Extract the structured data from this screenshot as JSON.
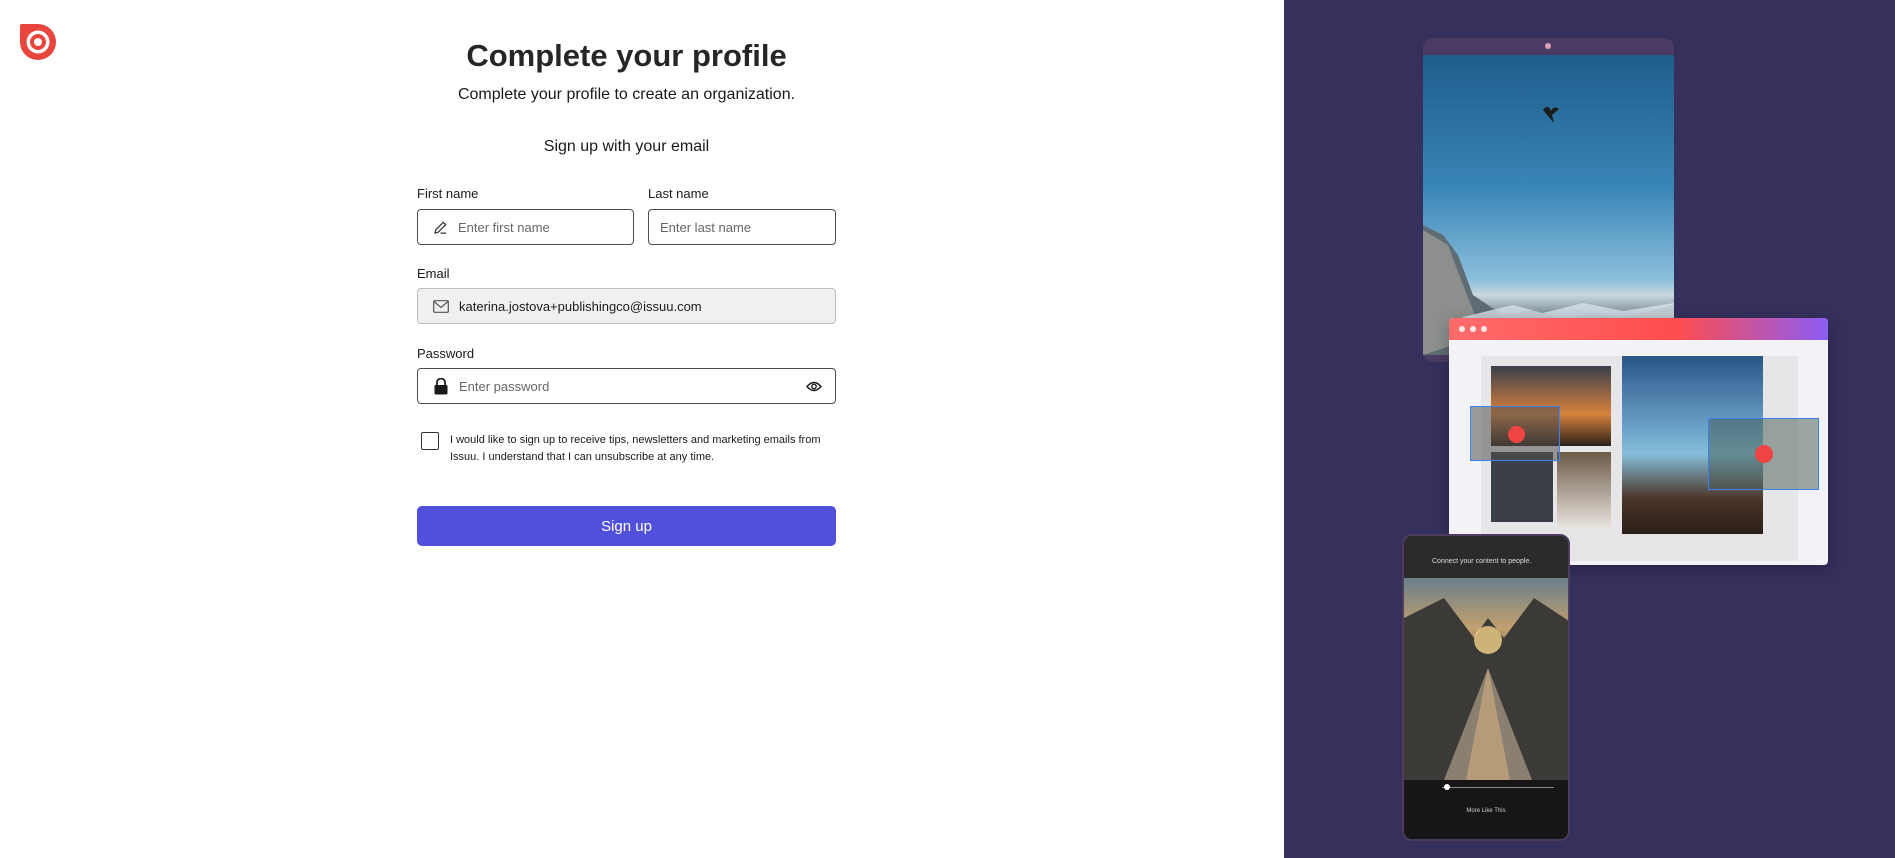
{
  "header": {
    "title": "Complete your profile",
    "subtitle": "Complete your profile to create an organization."
  },
  "form": {
    "section_title": "Sign up with your email",
    "first_name": {
      "label": "First name",
      "placeholder": "Enter first name",
      "icon": "pencil-icon"
    },
    "last_name": {
      "label": "Last name",
      "placeholder": "Enter last name"
    },
    "email": {
      "label": "Email",
      "value": "katerina.jostova+publishingco@issuu.com",
      "icon": "envelope-icon"
    },
    "password": {
      "label": "Password",
      "placeholder": "Enter password",
      "icon": "lock-icon",
      "toggle_icon": "eye-icon"
    },
    "consent": "I would like to sign up to receive tips, newsletters and marketing emails from Issuu. I understand that I can unsubscribe at any time.",
    "submit_label": "Sign up"
  },
  "colors": {
    "accent": "#5150dc",
    "logo": "#e8453c",
    "panel_bg": "#35305c"
  },
  "illustration": {
    "phone_header": "Connect your content to people.",
    "phone_footer": "More Like This"
  }
}
